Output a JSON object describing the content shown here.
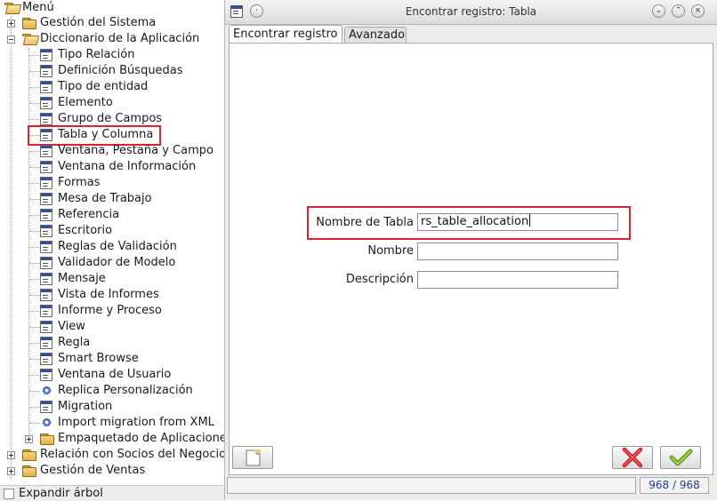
{
  "tree": {
    "root_label": "Menú",
    "items": [
      {
        "label": "Gestión del Sistema"
      },
      {
        "label": "Diccionario de la Aplicación"
      },
      {
        "label": "Tipo Relación"
      },
      {
        "label": "Definición Búsquedas"
      },
      {
        "label": "Tipo de entidad"
      },
      {
        "label": "Elemento"
      },
      {
        "label": "Grupo de Campos"
      },
      {
        "label": "Tabla y Columna"
      },
      {
        "label": "Ventana, Pestaña y Campo"
      },
      {
        "label": "Ventana de Información"
      },
      {
        "label": "Formas"
      },
      {
        "label": "Mesa de Trabajo"
      },
      {
        "label": "Referencia"
      },
      {
        "label": "Escritorio"
      },
      {
        "label": "Reglas de Validación"
      },
      {
        "label": "Validador de Modelo"
      },
      {
        "label": "Mensaje"
      },
      {
        "label": "Vista de Informes"
      },
      {
        "label": "Informe y Proceso"
      },
      {
        "label": "View"
      },
      {
        "label": "Regla"
      },
      {
        "label": "Smart Browse"
      },
      {
        "label": "Ventana de Usuario"
      },
      {
        "label": "Replica Personalización"
      },
      {
        "label": "Migration"
      },
      {
        "label": "Import migration from XML"
      },
      {
        "label": "Empaquetado de Aplicaciones"
      },
      {
        "label": "Relación con Socios del Negocio"
      },
      {
        "label": "Gestión de Ventas"
      }
    ],
    "expand_label": "Expandir árbol"
  },
  "dialog": {
    "title": "Encontrar registro: Tabla",
    "tabs": [
      {
        "label": "Encontrar registro"
      },
      {
        "label": "Avanzado"
      }
    ],
    "fields": [
      {
        "label": "Nombre de Tabla",
        "value": "rs_table_allocation"
      },
      {
        "label": "Nombre",
        "value": ""
      },
      {
        "label": "Descripción",
        "value": ""
      }
    ],
    "status_count": "968 / 968"
  },
  "colors": {
    "highlight": "#e0202a",
    "ok_green": "#6aa01e",
    "cancel_red": "#d0202a"
  }
}
